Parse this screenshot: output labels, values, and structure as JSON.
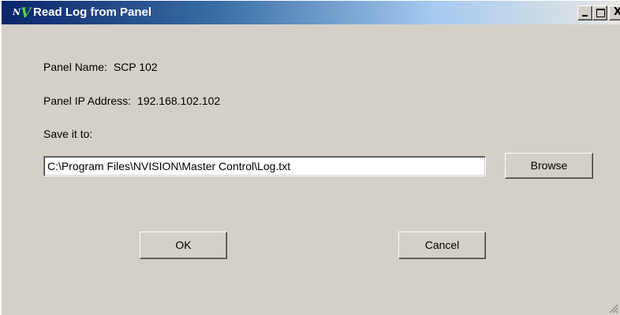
{
  "window": {
    "title": "Read Log from Panel",
    "logo": {
      "text": "V",
      "superscript": "N"
    }
  },
  "title_buttons": {
    "minimize_icon": "minimize-icon",
    "maximize_icon": "maximize-icon",
    "close_glyph": "X"
  },
  "panel_name": {
    "label": "Panel Name:",
    "value": "SCP 102"
  },
  "panel_ip": {
    "label": "Panel IP Address:",
    "value": "192.168.102.102"
  },
  "save_it_to": {
    "label": "Save it to:"
  },
  "save_path": {
    "value": "C:\\Program Files\\NVISION\\Master Control\\Log.txt"
  },
  "buttons": {
    "browse": "Browse",
    "ok": "OK",
    "cancel": "Cancel"
  },
  "colors": {
    "face": "#d4d0c8",
    "title_start": "#0a246a",
    "title_end": "#a6caf0",
    "logo": "#5bd14a"
  }
}
